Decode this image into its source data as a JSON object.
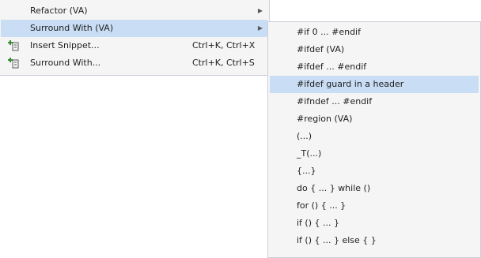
{
  "main_menu": {
    "items": [
      {
        "label": "Refactor (VA)",
        "shortcut": "",
        "has_submenu": true,
        "icon": null,
        "highlighted": false
      },
      {
        "label": "Surround With (VA)",
        "shortcut": "",
        "has_submenu": true,
        "icon": null,
        "highlighted": true
      },
      {
        "label": "Insert Snippet...",
        "shortcut": "Ctrl+K, Ctrl+X",
        "has_submenu": false,
        "icon": "insert-snippet-icon",
        "highlighted": false
      },
      {
        "label": "Surround With...",
        "shortcut": "Ctrl+K, Ctrl+S",
        "has_submenu": false,
        "icon": "surround-with-icon",
        "highlighted": false
      }
    ],
    "submenu_arrow": "▶"
  },
  "sub_menu": {
    "items": [
      {
        "label": "#if 0 ... #endif",
        "highlighted": false
      },
      {
        "label": "#ifdef (VA)",
        "highlighted": false
      },
      {
        "label": "#ifdef ... #endif",
        "highlighted": false
      },
      {
        "label": "#ifdef guard in a header",
        "highlighted": true
      },
      {
        "label": "#ifndef ... #endif",
        "highlighted": false
      },
      {
        "label": "#region (VA)",
        "highlighted": false
      },
      {
        "label": "(...)",
        "highlighted": false
      },
      {
        "label": "_T(...)",
        "highlighted": false
      },
      {
        "label": "{...}",
        "highlighted": false
      },
      {
        "label": "do { ... } while ()",
        "highlighted": false
      },
      {
        "label": "for () { ... }",
        "highlighted": false
      },
      {
        "label": "if () { ... }",
        "highlighted": false
      },
      {
        "label": "if () { ... } else { }",
        "highlighted": false
      }
    ]
  },
  "colors": {
    "menu_bg": "#f5f5f5",
    "highlight": "#c9def5",
    "border": "#cccedb",
    "icon_green": "#388a34"
  }
}
